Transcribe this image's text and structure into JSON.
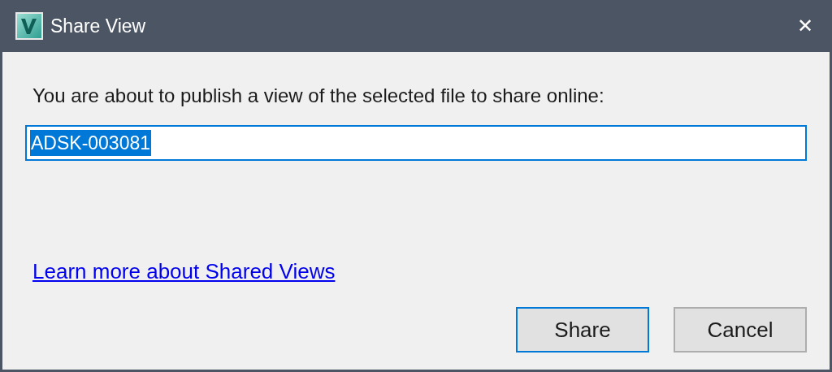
{
  "window": {
    "title": "Share View",
    "close": "✕"
  },
  "message": "You are about to publish a view of the selected file to share online:",
  "name_field": {
    "value": "ADSK-003081",
    "text_selected": true
  },
  "link": "Learn more about Shared Views",
  "buttons": [
    {
      "label": "Share",
      "default": true
    },
    {
      "label": "Cancel",
      "default": false
    }
  ]
}
